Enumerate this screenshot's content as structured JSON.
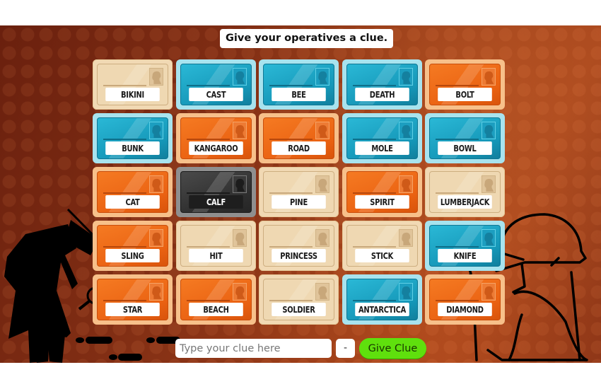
{
  "prompt": "Give your operatives a clue.",
  "colors": {
    "neutral": "#efd8b2",
    "blue": "#1ea8c8",
    "red": "#f06c18",
    "assassin": "#2e2e2e",
    "give_clue_button": "#5fe00d"
  },
  "board": {
    "cards": [
      {
        "word": "BIKINI",
        "type": "neutral"
      },
      {
        "word": "CAST",
        "type": "blue"
      },
      {
        "word": "BEE",
        "type": "blue"
      },
      {
        "word": "DEATH",
        "type": "blue"
      },
      {
        "word": "BOLT",
        "type": "red"
      },
      {
        "word": "BUNK",
        "type": "blue"
      },
      {
        "word": "KANGAROO",
        "type": "red"
      },
      {
        "word": "ROAD",
        "type": "red"
      },
      {
        "word": "MOLE",
        "type": "blue"
      },
      {
        "word": "BOWL",
        "type": "blue"
      },
      {
        "word": "CAT",
        "type": "red"
      },
      {
        "word": "CALF",
        "type": "assassin"
      },
      {
        "word": "PINE",
        "type": "neutral"
      },
      {
        "word": "SPIRIT",
        "type": "red"
      },
      {
        "word": "LUMBERJACK",
        "type": "neutral"
      },
      {
        "word": "SLING",
        "type": "red"
      },
      {
        "word": "HIT",
        "type": "neutral"
      },
      {
        "word": "PRINCESS",
        "type": "neutral"
      },
      {
        "word": "STICK",
        "type": "neutral"
      },
      {
        "word": "KNIFE",
        "type": "blue"
      },
      {
        "word": "STAR",
        "type": "red"
      },
      {
        "word": "BEACH",
        "type": "red"
      },
      {
        "word": "SOLDIER",
        "type": "neutral"
      },
      {
        "word": "ANTARCTICA",
        "type": "blue"
      },
      {
        "word": "DIAMOND",
        "type": "red"
      }
    ]
  },
  "clue_bar": {
    "input_value": "",
    "input_placeholder": "Type your clue here",
    "count_label": "-",
    "give_clue_label": "Give Clue"
  },
  "icons": {
    "card_portrait": "agent-silhouette-icon",
    "left_decoration": "detective-with-magnifier-icon",
    "right_decoration": "detective-outline-icon",
    "footprints": "footprints-icon"
  }
}
